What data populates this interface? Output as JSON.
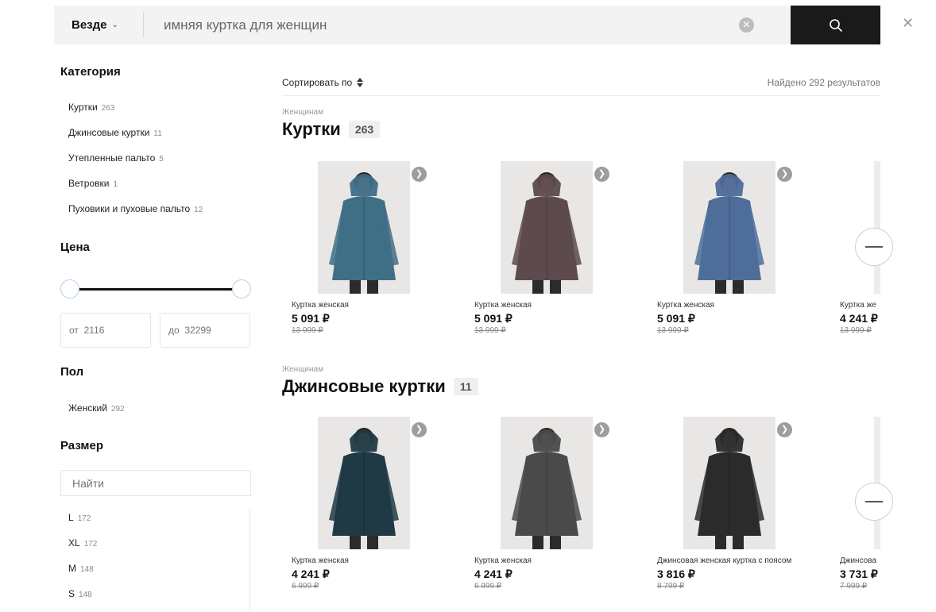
{
  "search": {
    "scope_label": "Везде",
    "query": "имняя куртка для женщин"
  },
  "sidebar": {
    "category_title": "Категория",
    "categories": [
      {
        "label": "Куртки",
        "count": "263"
      },
      {
        "label": "Джинсовые куртки",
        "count": "11"
      },
      {
        "label": "Утепленные пальто",
        "count": "5"
      },
      {
        "label": "Ветровки",
        "count": "1"
      },
      {
        "label": "Пуховики и пуховые пальто",
        "count": "12"
      }
    ],
    "price_title": "Цена",
    "price_from_placeholder": "от  2116",
    "price_to_placeholder": "до  32299",
    "gender_title": "Пол",
    "genders": [
      {
        "label": "Женский",
        "count": "292"
      }
    ],
    "size_title": "Размер",
    "size_search_placeholder": "Найти",
    "sizes": [
      {
        "label": "L",
        "count": "172"
      },
      {
        "label": "XL",
        "count": "172"
      },
      {
        "label": "M",
        "count": "148"
      },
      {
        "label": "S",
        "count": "148"
      }
    ]
  },
  "results": {
    "sort_label": "Сортировать по",
    "found_label": "Найдено 292 результатов"
  },
  "sections": [
    {
      "kicker": "Женщинам",
      "title": "Куртки",
      "count": "263",
      "products": [
        {
          "name": "Куртка женская",
          "price": "5 091 ₽",
          "old_price": "13 999 ₽",
          "color": "#3f6f86"
        },
        {
          "name": "Куртка женская",
          "price": "5 091 ₽",
          "old_price": "13 999 ₽",
          "color": "#5d4a4e"
        },
        {
          "name": "Куртка женская",
          "price": "5 091 ₽",
          "old_price": "13 999 ₽",
          "color": "#4e6d9a"
        },
        {
          "name": "Куртка же",
          "price": "4 241 ₽",
          "old_price": "13 999 ₽",
          "color": "#dcdcdc"
        }
      ]
    },
    {
      "kicker": "Женщинам",
      "title": "Джинсовые куртки",
      "count": "11",
      "products": [
        {
          "name": "Куртка женская",
          "price": "4 241 ₽",
          "old_price": "6 999 ₽",
          "color": "#1f3a45"
        },
        {
          "name": "Куртка женская",
          "price": "4 241 ₽",
          "old_price": "6 999 ₽",
          "color": "#4a4a4a"
        },
        {
          "name": "Джинсовая женская куртка с поясом",
          "price": "3 816 ₽",
          "old_price": "8 799 ₽",
          "color": "#2b2b2b"
        },
        {
          "name": "Джинсова",
          "price": "3 731 ₽",
          "old_price": "7 999 ₽",
          "color": "#1a1a1a"
        }
      ]
    }
  ]
}
